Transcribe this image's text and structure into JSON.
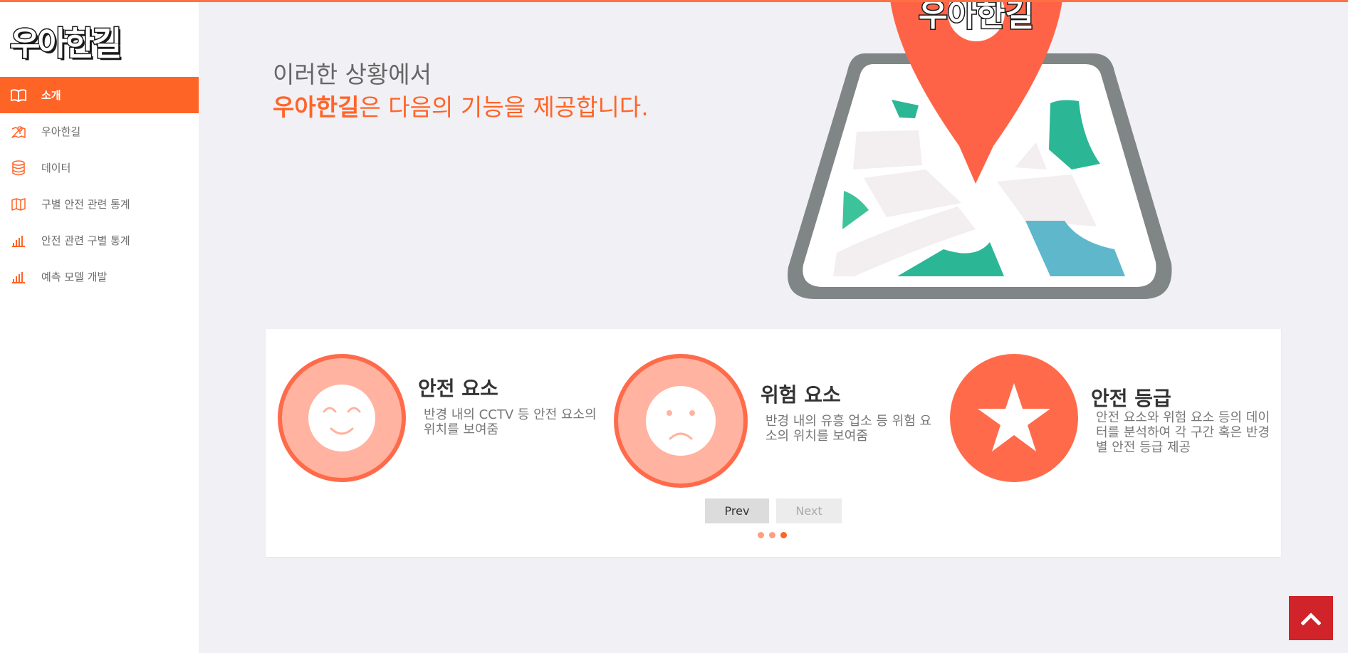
{
  "brand": {
    "logo_text": "우아한길"
  },
  "sidebar": {
    "items": [
      {
        "label": "소개",
        "icon": "open-book-icon",
        "active": true
      },
      {
        "label": "우아한길",
        "icon": "map-pin-icon",
        "active": false
      },
      {
        "label": "데이터",
        "icon": "database-icon",
        "active": false
      },
      {
        "label": "구별 안전 관련 통계",
        "icon": "map-icon",
        "active": false
      },
      {
        "label": "안전 관련 구별 통계",
        "icon": "bar-chart-icon",
        "active": false
      },
      {
        "label": "예측 모델 개발",
        "icon": "bar-chart-icon",
        "active": false
      }
    ]
  },
  "hero": {
    "line1": "이러한 상황에서",
    "line2_highlight": "우아한길",
    "line2_rest": "은 다음의 기능을 제공합니다.",
    "art_logo_text": "우아한길"
  },
  "features": [
    {
      "title": "안전 요소",
      "description": "반경 내의 CCTV 등 안전 요소의 위치를 보여줌",
      "icon": "smile-face-icon"
    },
    {
      "title": "위험 요소",
      "description": "반경 내의 유흥 업소 등 위험 요소의 위치를 보여줌",
      "icon": "sad-face-icon"
    },
    {
      "title": "안전 등급",
      "description": "안전 요소와 위험 요소 등의 데이터를 분석하여 각 구간 혹은 반경 별 안전 등급 제공",
      "icon": "star-icon"
    }
  ],
  "pager": {
    "prev_label": "Prev",
    "next_label": "Next",
    "dot_count": 3,
    "active_dot": 3
  },
  "colors": {
    "accent": "#ff6427",
    "accent_light": "#ffb3a0",
    "scroll_top_bg": "#d0232a",
    "sidebar_bg": "#ffffff",
    "page_bg": "#f0f0f5"
  },
  "scroll_top": {
    "icon": "chevron-up-icon"
  }
}
